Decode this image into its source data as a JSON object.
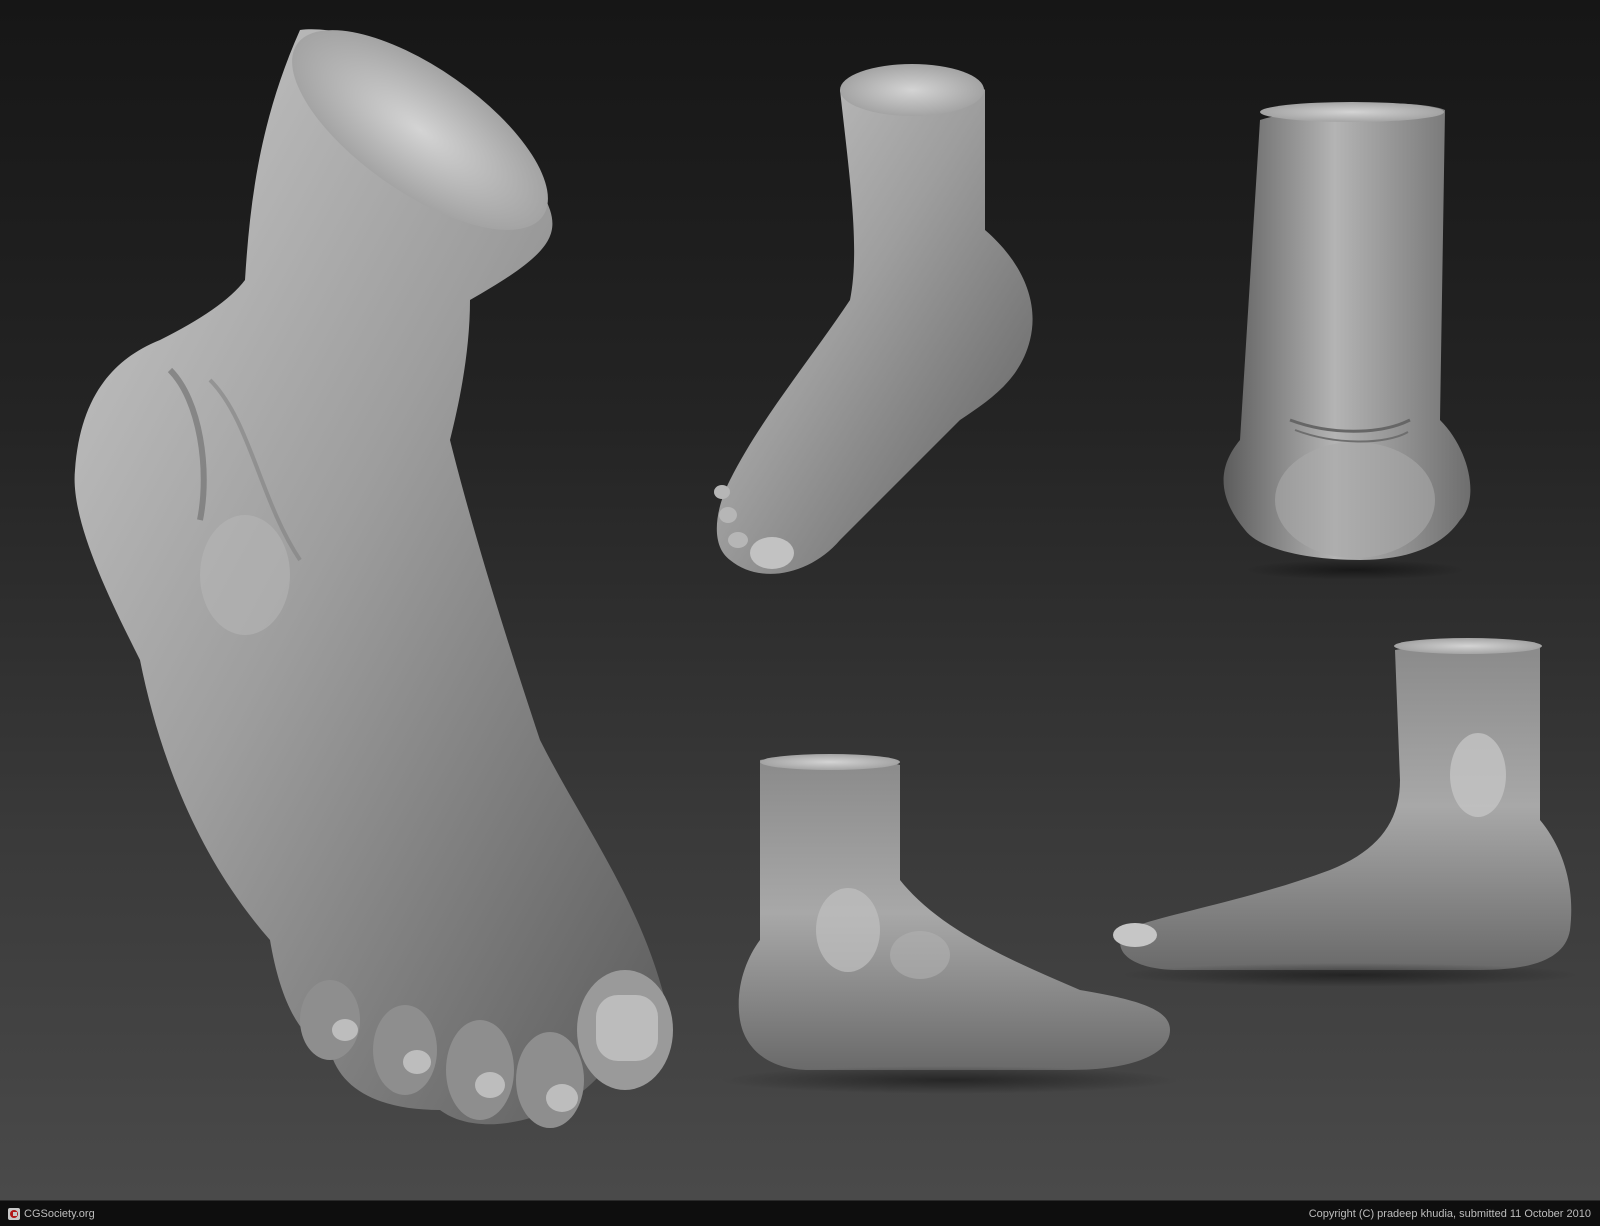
{
  "footer": {
    "brand_label": "CGSociety.org",
    "brand_icon": "cgsociety-logo-icon",
    "copyright": "Copyright (C) pradeep khudia, submitted 11 October 2010"
  },
  "render": {
    "subject": "foot-sculpt",
    "views": [
      "three-quarter-closeup",
      "top-three-quarter",
      "back",
      "side-outer",
      "side-inner"
    ],
    "background_top": "#161616",
    "background_bottom": "#4a4a4a",
    "clay_color": "#a9a9a9"
  }
}
